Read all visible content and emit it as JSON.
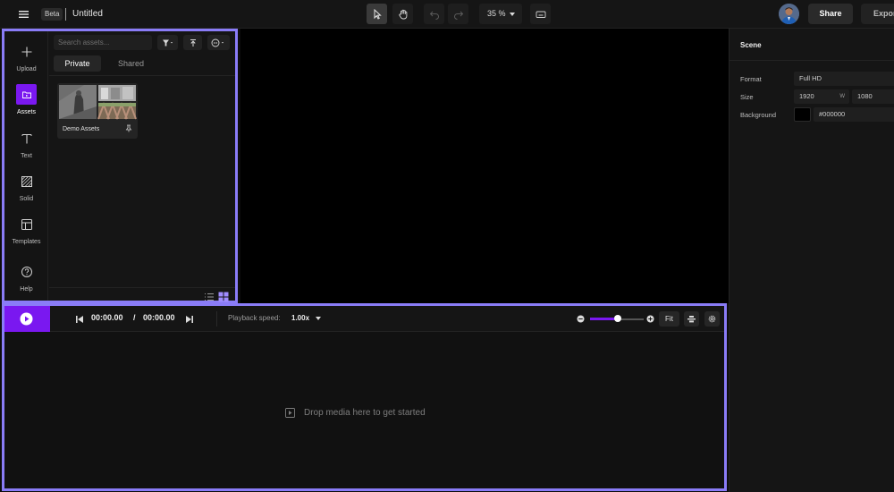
{
  "header": {
    "beta_badge": "Beta",
    "title": "Untitled",
    "zoom": "35 %",
    "share_label": "Share",
    "export_label": "Export"
  },
  "rail": {
    "items": [
      {
        "label": "Upload",
        "icon": "plus-icon"
      },
      {
        "label": "Assets",
        "icon": "folder-icon",
        "active": true
      },
      {
        "label": "Text",
        "icon": "text-icon"
      },
      {
        "label": "Solid",
        "icon": "hatched-square-icon"
      },
      {
        "label": "Templates",
        "icon": "layout-icon"
      },
      {
        "label": "Help",
        "icon": "question-icon"
      }
    ]
  },
  "assets": {
    "search_placeholder": "Search assets...",
    "tabs": [
      "Private",
      "Shared"
    ],
    "active_tab": "Private",
    "folder": {
      "name": "Demo Assets"
    }
  },
  "scene": {
    "title": "Scene",
    "format_label": "Format",
    "format_value": "Full HD",
    "size_label": "Size",
    "width": "1920",
    "w_label": "W",
    "height": "1080",
    "background_label": "Background",
    "background_value": "#000000",
    "background_color": "#000000"
  },
  "timeline": {
    "current_time": "00:00.00",
    "separator": "/",
    "total_time": "00:00.00",
    "playback_label": "Playback speed:",
    "playback_value": "1.00x",
    "fit_label": "Fit",
    "drop_message": "Drop media here to get started"
  },
  "colors": {
    "accent": "#7a18f0",
    "outline": "#8a7cf7"
  }
}
